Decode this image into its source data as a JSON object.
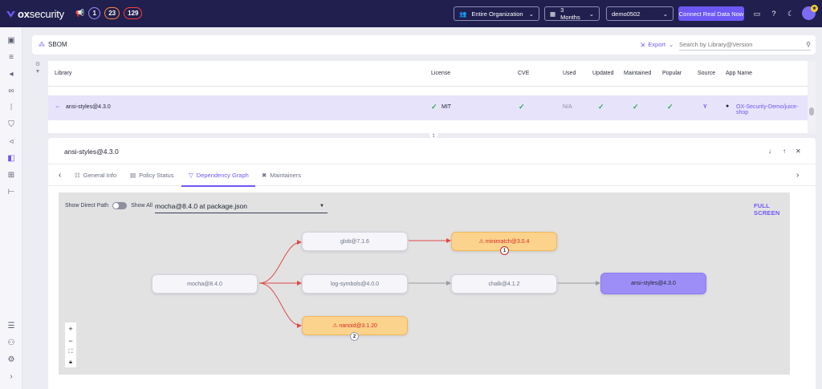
{
  "brand": {
    "name_bold": "ox",
    "name_rest": "security"
  },
  "alerts": {
    "count1": "1",
    "count2": "23",
    "count3": "129"
  },
  "filters": {
    "organization": "Entire Organization",
    "period": "3 Months",
    "env": "demo0502",
    "connect_label": "Connect Real Data Now"
  },
  "sbom": {
    "title": "SBOM",
    "export_label": "Export",
    "search_placeholder": "Search by Library@Version"
  },
  "table": {
    "headers": [
      "Library",
      "License",
      "CVE",
      "Used",
      "Updated",
      "Maintained",
      "Popular",
      "Source",
      "App Name"
    ],
    "selected_row": {
      "library": "ansi-styles@4.3.0",
      "license": "MIT",
      "used": "N/A",
      "source": "Y",
      "app": "OX-Security-Demo/juice-shop"
    }
  },
  "detail": {
    "title": "ansi-styles@4.3.0",
    "tabs": [
      "General Info",
      "Policy Status",
      "Dependency Graph",
      "Maintainers"
    ],
    "active_tab": "Dependency Graph"
  },
  "graph": {
    "show_direct_path": "Show Direct Path",
    "show_all": "Show All",
    "path_value": "mocha@8.4.0 at package.json",
    "full_screen": "FULL SCREEN",
    "nodes": {
      "mocha": "mocha@8.4.0",
      "glob": "glob@7.1.6",
      "minimatch": "minimatch@3.0.4",
      "log_symbols": "log-symbols@4.0.0",
      "chalk": "chalk@4.1.2",
      "ansi": "ansi-styles@4.3.0",
      "nanoid": "nanoid@3.1.20"
    },
    "badges": {
      "minimatch": "1",
      "nanoid": "2"
    }
  },
  "colors": {
    "topbar": "#211f4e",
    "accent": "#6e58f5",
    "selected_row": "#e7e3fb",
    "warning_node": "#fcd38c",
    "target_node": "#9d8ef7",
    "edge_red": "#e04848",
    "check_green": "#2fa84f"
  }
}
